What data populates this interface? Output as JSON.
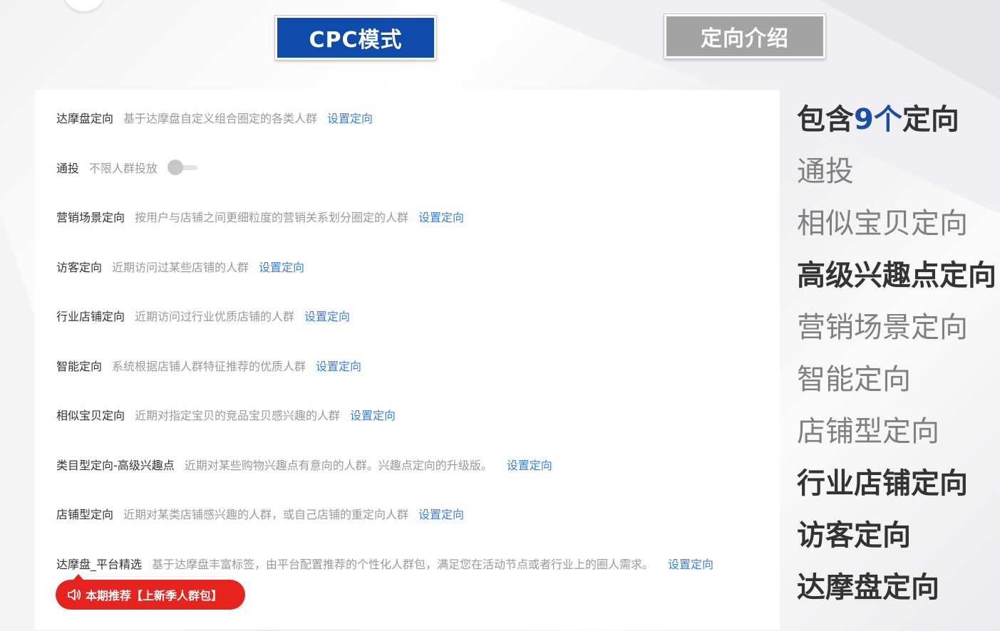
{
  "colors": {
    "cpc_tab_bg": "#0f4bab",
    "intro_tab_bg": "#a3a3a3",
    "link": "#3b7fe0",
    "badge": "#e6231f",
    "highlight_number": "#1a4fa8"
  },
  "tabs": {
    "cpc": "CPC模式",
    "intro": "定向介绍"
  },
  "rows": [
    {
      "label": "达摩盘定向",
      "desc": "基于达摩盘自定义组合圈定的各类人群",
      "link": "设置定向"
    },
    {
      "label": "通投",
      "desc": "不限人群投放",
      "toggle_on": false
    },
    {
      "label": "营销场景定向",
      "desc": "按用户与店铺之间更细粒度的营销关系划分圈定的人群",
      "link": "设置定向"
    },
    {
      "label": "访客定向",
      "desc": "近期访问过某些店铺的人群",
      "link": "设置定向"
    },
    {
      "label": "行业店铺定向",
      "desc": "近期访问过行业优质店铺的人群",
      "link": "设置定向"
    },
    {
      "label": "智能定向",
      "desc": "系统根据店铺人群特征推荐的优质人群",
      "link": "设置定向"
    },
    {
      "label": "相似宝贝定向",
      "desc": "近期对指定宝贝的竞品宝贝感兴趣的人群",
      "link": "设置定向"
    },
    {
      "label": "类目型定向-高级兴趣点",
      "desc": "近期对某些购物兴趣点有意向的人群。兴趣点定向的升级版。",
      "link": "设置定向"
    },
    {
      "label": "店铺型定向",
      "desc": "近期对某类店铺感兴趣的人群，或自己店铺的重定向人群",
      "link": "设置定向"
    },
    {
      "label": "达摩盘_平台精选",
      "desc": "基于达摩盘丰富标签，由平台配置推荐的个性化人群包，满足您在活动节点或者行业上的圈人需求。",
      "link": "设置定向"
    }
  ],
  "recommend_badge": {
    "icon": "speaker-icon",
    "text": "本期推荐【上新季人群包】"
  },
  "side": {
    "head_prefix": "包含",
    "head_num": "9个",
    "head_suffix": "定向",
    "items": [
      {
        "text": "通投",
        "style": "light"
      },
      {
        "text": "相似宝贝定向",
        "style": "light"
      },
      {
        "text": "高级兴趣点定向",
        "style": "bold"
      },
      {
        "text": "营销场景定向",
        "style": "light"
      },
      {
        "text": "智能定向",
        "style": "light"
      },
      {
        "text": "店铺型定向",
        "style": "light"
      },
      {
        "text": "行业店铺定向",
        "style": "bold"
      },
      {
        "text": "访客定向",
        "style": "bold"
      },
      {
        "text": "达摩盘定向",
        "style": "bold"
      }
    ]
  }
}
